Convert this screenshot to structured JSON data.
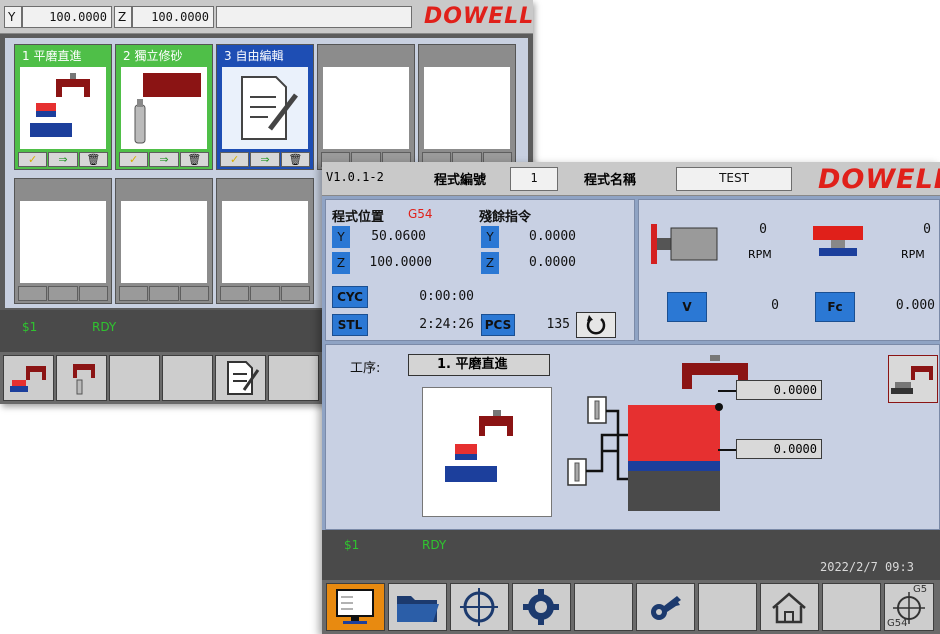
{
  "back": {
    "y_label": "Y",
    "y_value": "100.0000",
    "z_label": "Z",
    "z_value": "100.0000",
    "logo": "DOWELL",
    "tiles": [
      {
        "title": "1 平磨直進",
        "color": "green"
      },
      {
        "title": "2 獨立修砂",
        "color": "green"
      },
      {
        "title": "3 自由編輯",
        "color": "blue"
      },
      {
        "title": "",
        "color": "empty"
      },
      {
        "title": "",
        "color": "empty"
      }
    ],
    "actions": [
      "✓",
      "⇒",
      "🗑"
    ],
    "status_left": "$1",
    "status_rdy": "RDY"
  },
  "front": {
    "version": "V1.0.1-2",
    "program_no_label": "程式編號",
    "program_no": "1",
    "program_name_label": "程式名稱",
    "program_name": "TEST",
    "logo": "DOWELL",
    "position_label": "程式位置",
    "g_code": "G54",
    "remaining_label": "殘餘指令",
    "pos_y_axis": "Y",
    "pos_y": "50.0600",
    "pos_z_axis": "Z",
    "pos_z": "100.0000",
    "rem_y_axis": "Y",
    "rem_y": "0.0000",
    "rem_z_axis": "Z",
    "rem_z": "0.0000",
    "cyc_label": "CYC",
    "cyc_time": "0:00:00",
    "stl_label": "STL",
    "stl_time": "2:24:26",
    "pcs_label": "PCS",
    "pcs_value": "135",
    "spindle1_value": "0",
    "spindle1_unit": "RPM",
    "spindle2_value": "0",
    "spindle2_unit": "RPM",
    "v_label": "V",
    "v_value": "0",
    "fc_label": "Fc",
    "fc_value": "0.000",
    "process_label": "工序:",
    "process_name": "1. 平磨直進",
    "out1": "0.0000",
    "out2": "0.0000",
    "status_left": "$1",
    "status_rdy": "RDY",
    "datetime": "2022/2/7 09:3",
    "g54_top": "G5",
    "g54_bottom": "G54"
  },
  "colors": {
    "logo_red": "#e0201a",
    "axis_blue": "#2b78d4",
    "status_green": "#2fc42f",
    "tile_green": "#4fbf48",
    "tile_blue": "#1e4eb4"
  }
}
